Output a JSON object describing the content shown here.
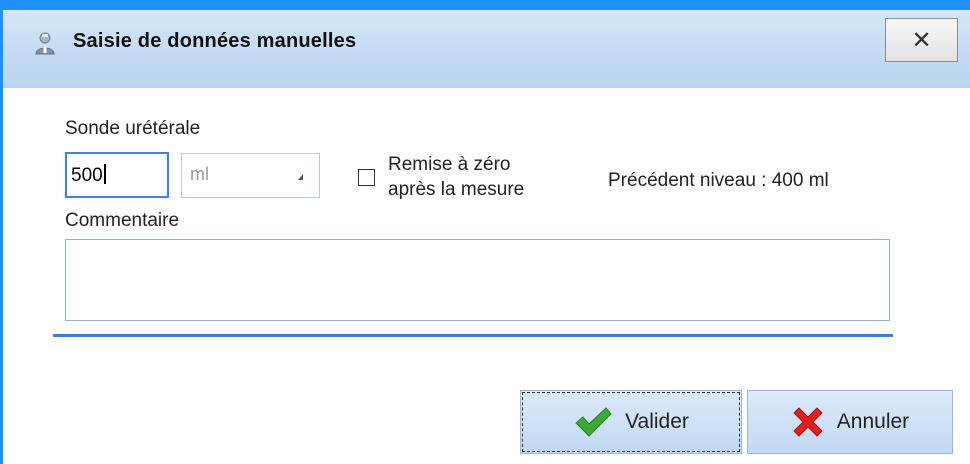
{
  "window": {
    "title": "Saisie de données manuelles",
    "close_label": "✕"
  },
  "form": {
    "probe_label": "Sonde urétérale",
    "volume_value": "500",
    "unit_selected": "ml",
    "reset_checkbox_label_line1": "Remise à zéro",
    "reset_checkbox_label_line2": "après la mesure",
    "reset_checked": false,
    "previous_level": "Précédent niveau : 400 ml",
    "comment_label": "Commentaire",
    "comment_value": ""
  },
  "buttons": {
    "validate_label": "Valider",
    "cancel_label": "Annuler"
  },
  "colors": {
    "accent": "#1e90ff",
    "validate_check": "#3aa935",
    "cancel_cross": "#e02020"
  },
  "icons": {
    "title": "user-doctor-icon",
    "validate": "checkmark-icon",
    "cancel": "cross-icon"
  }
}
